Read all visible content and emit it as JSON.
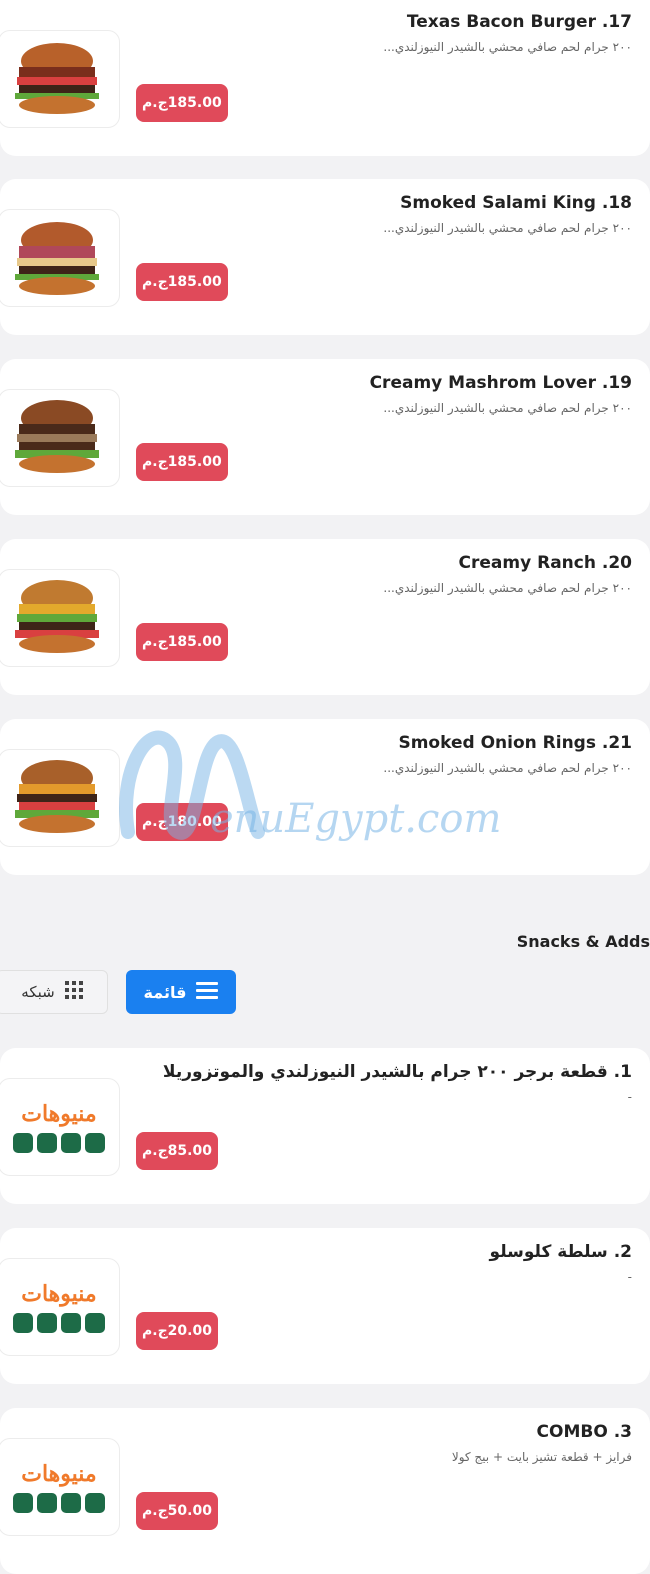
{
  "currency_symbol": "ج.م",
  "burgers": [
    {
      "title": "Texas Bacon Burger .17",
      "desc": "٢٠٠ جرام لحم صافي محشي بالشيدر النيوزلندي...",
      "price": "185.00ج.م"
    },
    {
      "title": "Smoked Salami King .18",
      "desc": "٢٠٠ جرام لحم صافي محشي بالشيدر النيوزلندي...",
      "price": "185.00ج.م"
    },
    {
      "title": "Creamy Mashrom Lover .19",
      "desc": "٢٠٠ جرام لحم صافي محشي بالشيدر النيوزلندي...",
      "price": "185.00ج.م"
    },
    {
      "title": "Creamy Ranch .20",
      "desc": "٢٠٠ جرام لحم صافي محشي بالشيدر النيوزلندي...",
      "price": "185.00ج.م"
    },
    {
      "title": "Smoked Onion Rings .21",
      "desc": "٢٠٠ جرام لحم صافي محشي بالشيدر النيوزلندي...",
      "price": "180.00ج.م"
    }
  ],
  "section": {
    "title": "Snacks & Adds"
  },
  "view_toggle": {
    "list_label": "قائمة",
    "grid_label": "شبكه"
  },
  "snacks": [
    {
      "title": "1. قطعة برجر ٢٠٠ جرام بالشيدر النيوزلندي والموتزوريلا",
      "desc": "-",
      "price": "85.00ج.م"
    },
    {
      "title": "2. سلطة كلوسلو",
      "desc": "-",
      "price": "20.00ج.م"
    },
    {
      "title": "COMBO .3",
      "desc": "فرايز + قطعة تشيز بايت + بيج كولا",
      "price": "50.00ج.م"
    }
  ],
  "logo": {
    "text": "منيوهات"
  },
  "watermark": {
    "text": "enuEgypt.com"
  }
}
